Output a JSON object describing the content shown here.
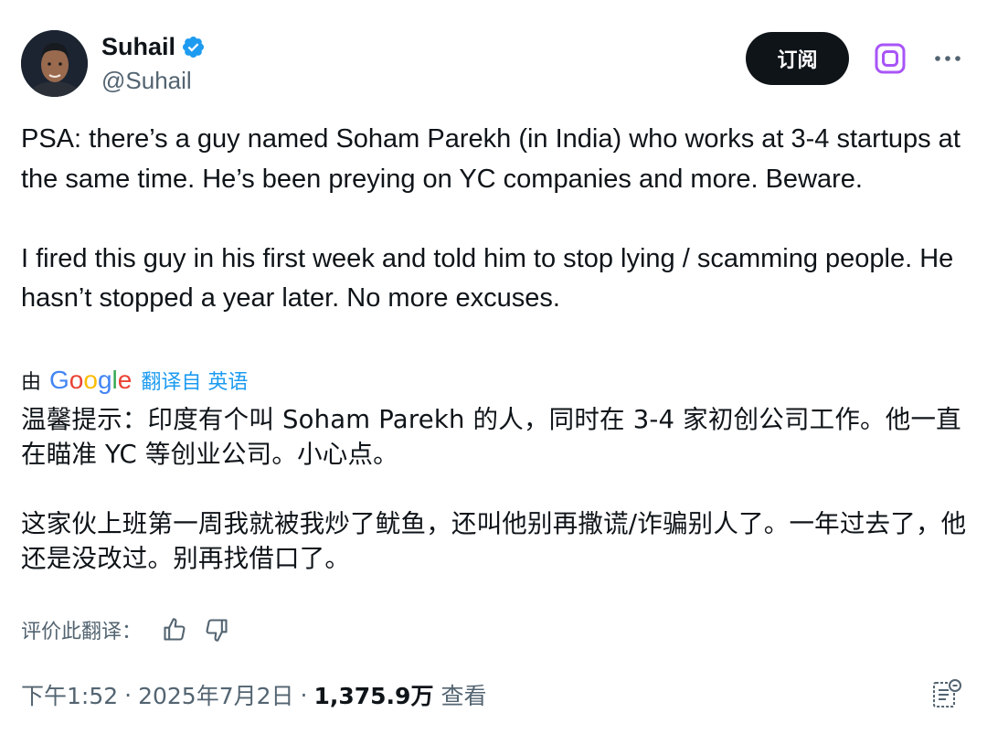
{
  "author": {
    "display_name": "Suhail",
    "handle": "@Suhail",
    "verified": true,
    "verified_color": "#1d9bf0"
  },
  "header": {
    "subscribe_label": "订阅",
    "grok_icon": "grok-icon",
    "more_icon": "more-dots-icon"
  },
  "tweet": {
    "paragraphs": [
      "PSA: there’s a guy named Soham Parekh (in India) who works at 3-4 startups at the same time. He’s been preying on YC companies and more. Beware.",
      "I fired this guy in his first week and told him to stop lying / scamming people. He hasn’t stopped a year later. No more excuses."
    ]
  },
  "translation": {
    "by_label": "由",
    "provider": "Google",
    "from_label": "翻译自 英语",
    "paragraphs": [
      "温馨提示：印度有个叫 Soham Parekh 的人，同时在 3-4 家初创公司工作。他一直在瞄准 YC 等创业公司。小心点。",
      "这家伙上班第一周我就被我炒了鱿鱼，还叫他别再撒谎/诈骗别人了。一年过去了，他还是没改过。别再找借口了。"
    ],
    "rate_label": "评价此翻译："
  },
  "meta": {
    "time": "下午1:52",
    "date": "2025年7月2日",
    "separator": "·",
    "views_count": "1,375.9万",
    "views_label": "查看"
  },
  "colors": {
    "text": "#0f1419",
    "secondary": "#536471",
    "accent": "#1d9bf0",
    "grok": "#a855f7"
  }
}
